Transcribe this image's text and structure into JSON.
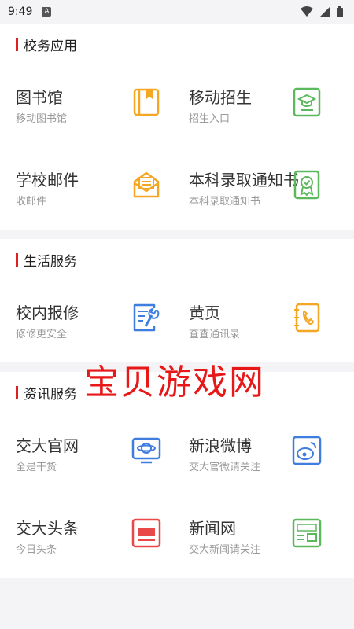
{
  "statusbar": {
    "time": "9:49",
    "badge": "A"
  },
  "sections": [
    {
      "title": "校务应用",
      "items": [
        {
          "title": "图书馆",
          "subtitle": "移动图书馆",
          "icon": "book-icon",
          "color": "#f5a623"
        },
        {
          "title": "移动招生",
          "subtitle": "招生入口",
          "icon": "graduation-cap-icon",
          "color": "#5cb85c"
        },
        {
          "title": "学校邮件",
          "subtitle": "收邮件",
          "icon": "mail-icon",
          "color": "#f5a623"
        },
        {
          "title": "本科录取通知书",
          "subtitle": "本科录取通知书",
          "icon": "certificate-icon",
          "color": "#5cb85c"
        }
      ]
    },
    {
      "title": "生活服务",
      "items": [
        {
          "title": "校内报修",
          "subtitle": "修修更安全",
          "icon": "wrench-document-icon",
          "color": "#3f7de0"
        },
        {
          "title": "黄页",
          "subtitle": "查查通讯录",
          "icon": "phone-book-icon",
          "color": "#f5a623"
        }
      ]
    },
    {
      "title": "资讯服务",
      "items": [
        {
          "title": "交大官网",
          "subtitle": "全是干货",
          "icon": "planet-monitor-icon",
          "color": "#3f7de0"
        },
        {
          "title": "新浪微博",
          "subtitle": "交大官微请关注",
          "icon": "weibo-icon",
          "color": "#3f7de0"
        },
        {
          "title": "交大头条",
          "subtitle": "今日头条",
          "icon": "toutiao-icon",
          "color": "#e84848"
        },
        {
          "title": "新闻网",
          "subtitle": "交大新闻请关注",
          "icon": "news-icon",
          "color": "#5cb85c"
        }
      ]
    }
  ],
  "watermark": "宝贝游戏网"
}
